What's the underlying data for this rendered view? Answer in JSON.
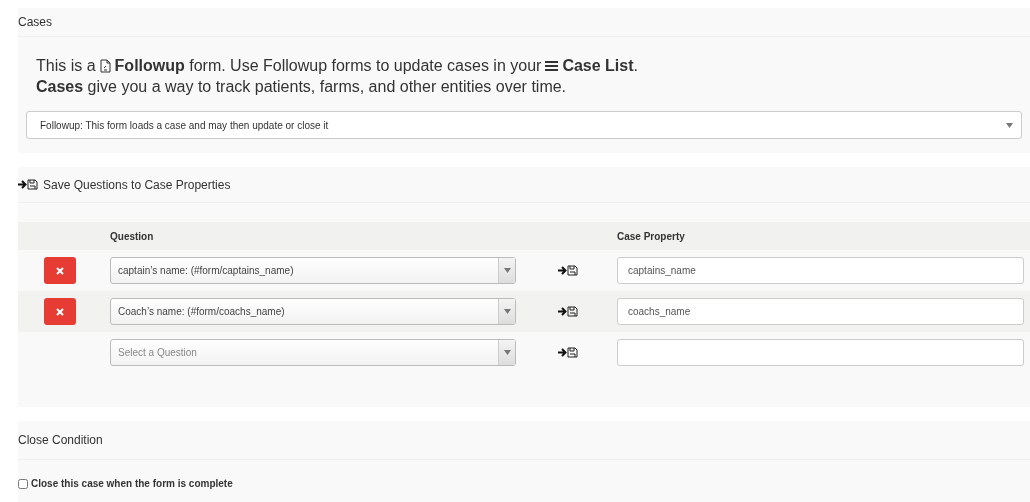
{
  "cases_panel": {
    "title": "Cases",
    "intro_lines": [
      [
        {
          "kind": "text",
          "text": "This is a"
        },
        {
          "kind": "file-icon"
        },
        {
          "kind": "text",
          "text": "**Followup** form. Use Followup forms to update cases in your"
        },
        {
          "kind": "list-icon"
        },
        {
          "kind": "text",
          "text": "**Case List**."
        }
      ],
      [
        {
          "kind": "text",
          "text": "**Cases** give you a way to track patients, farms, and other entities over time."
        }
      ]
    ],
    "form_type_select": {
      "value": "Followup: This form loads a case and may then update or close it"
    }
  },
  "save_panel": {
    "title": "Save Questions to Case Properties",
    "table": {
      "columns": [
        "Question",
        "Case Property"
      ],
      "rows": [
        {
          "kind": "saved",
          "question": {
            "value": "captain’s name: (#form/captains_name)"
          },
          "case_property": {
            "value": "captains_name"
          }
        },
        {
          "kind": "saved",
          "question": {
            "value": "Coach’s name: (#form/coachs_name)"
          },
          "case_property": {
            "value": "coachs_name"
          }
        },
        {
          "kind": "new",
          "question": {
            "placeholder": "Select a Question"
          },
          "case_property": {}
        }
      ]
    }
  },
  "close_panel": {
    "title": "Close Condition",
    "close_checkbox": {
      "label": "Close this case when the form is complete",
      "checked": false
    }
  }
}
